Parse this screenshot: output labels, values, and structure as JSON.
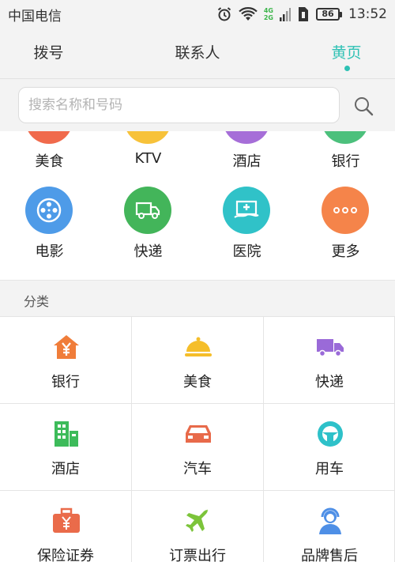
{
  "status_bar": {
    "carrier": "中国电信",
    "network_type_top": "4G",
    "network_type_bottom": "2G",
    "battery": "86",
    "time": "13:52"
  },
  "tabs": [
    {
      "label": "拨号",
      "active": false
    },
    {
      "label": "联系人",
      "active": false
    },
    {
      "label": "黄页",
      "active": true
    }
  ],
  "search": {
    "placeholder": "搜索名称和号码",
    "icon": "search-icon"
  },
  "quick_services": [
    {
      "label": "美食",
      "icon": "food-icon",
      "color": "#f06a4c"
    },
    {
      "label": "KTV",
      "icon": "ktv-icon",
      "color": "#f7c23a"
    },
    {
      "label": "酒店",
      "icon": "hotel-icon",
      "color": "#a66ed8"
    },
    {
      "label": "银行",
      "icon": "bank-icon",
      "color": "#4cc07c"
    },
    {
      "label": "电影",
      "icon": "film-reel-icon",
      "color": "#4e9be8"
    },
    {
      "label": "快递",
      "icon": "delivery-truck-icon",
      "color": "#43b55a"
    },
    {
      "label": "医院",
      "icon": "hospital-icon",
      "color": "#30c2c8"
    },
    {
      "label": "更多",
      "icon": "more-dots-icon",
      "color": "#f5844a"
    }
  ],
  "categories": {
    "title": "分类",
    "items": [
      {
        "label": "银行",
        "icon": "bank-house-icon",
        "color": "#f07d3a"
      },
      {
        "label": "美食",
        "icon": "food-cloche-icon",
        "color": "#f5be2a"
      },
      {
        "label": "快递",
        "icon": "delivery-truck-icon",
        "color": "#9a6ad8"
      },
      {
        "label": "酒店",
        "icon": "hotel-building-icon",
        "color": "#3dbb5a"
      },
      {
        "label": "汽车",
        "icon": "car-icon",
        "color": "#e86a4a"
      },
      {
        "label": "用车",
        "icon": "steering-wheel-icon",
        "color": "#2ec1c9"
      },
      {
        "label": "保险证券",
        "icon": "briefcase-yen-icon",
        "color": "#ea6b4a"
      },
      {
        "label": "订票出行",
        "icon": "airplane-icon",
        "color": "#7cc43a"
      },
      {
        "label": "品牌售后",
        "icon": "customer-service-icon",
        "color": "#4e8fe6"
      }
    ]
  }
}
